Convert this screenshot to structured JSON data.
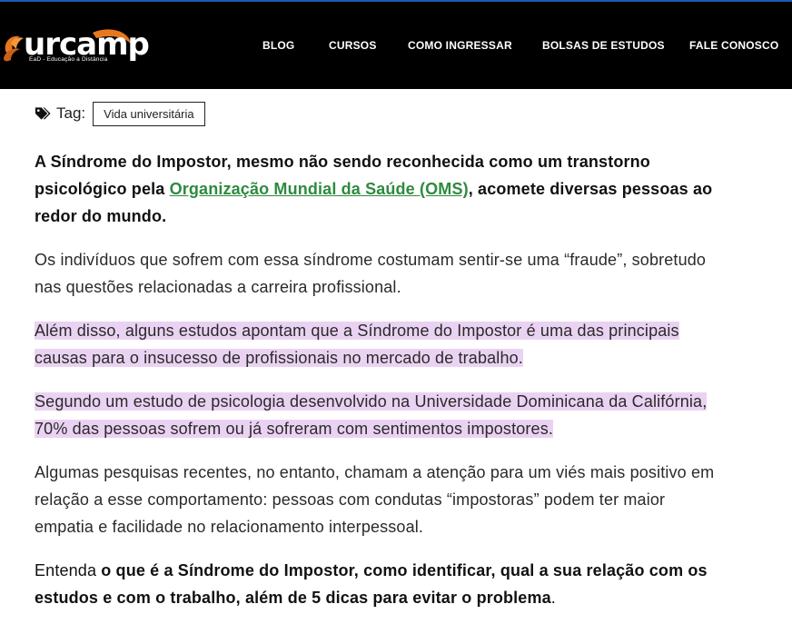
{
  "header": {
    "logo_text": "urcamp",
    "logo_subtitle": "EaD - Educação a Distância",
    "nav": [
      {
        "label": "BLOG"
      },
      {
        "label": "CURSOS"
      },
      {
        "label": "COMO INGRESSAR"
      },
      {
        "label": "BOLSAS DE ESTUDOS"
      },
      {
        "label": "FALE CONOSCO"
      }
    ],
    "colors": {
      "background": "#000000",
      "top_border": "#1f56b3",
      "logo_accent": "#e8781e"
    }
  },
  "tags": {
    "icon": "tags-icon",
    "label": "Tag:",
    "items": [
      "Vida universitária"
    ]
  },
  "article": {
    "intro_part1": "A Síndrome do Impostor, mesmo não sendo reconhecida como um transtorno psicológico pela ",
    "intro_link": "Organização Mundial da Saúde (OMS)",
    "intro_part2": ", acomete diversas pessoas ao redor do mundo.",
    "para2": "Os indivíduos que sofrem com essa síndrome costumam sentir-se uma “fraude”, sobretudo nas questões relacionadas a carreira profissional.",
    "para3": "Além disso, alguns estudos apontam que a Síndrome do Impostor é uma das principais causas para o insucesso de profissionais no mercado de trabalho.",
    "para4": "Segundo um estudo de psicologia desenvolvido na Universidade Dominicana da Califórnia, 70% das pessoas sofrem ou já sofreram com sentimentos impostores.",
    "para5": "Algumas pesquisas recentes, no entanto, chamam a atenção para um viés mais positivo em relação a esse comportamento: pessoas com condutas “impostoras” podem ter maior empatia e facilidade no relacionamento interpessoal.",
    "para6_prefix": "Entenda ",
    "para6_bold": "o que é a Síndrome do Impostor, como identificar, qual a sua relação com os estudos e com o trabalho, além de 5 dicas para evitar o problema",
    "para6_suffix": ".",
    "colors": {
      "link": "#2e8a3f",
      "highlight": "#ead3f2"
    }
  }
}
